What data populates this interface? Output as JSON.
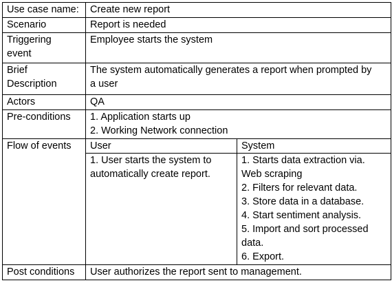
{
  "rows": {
    "use_case_name": {
      "label": "Use case name:",
      "value": "Create new report"
    },
    "scenario": {
      "label": "Scenario",
      "value": "Report is needed"
    },
    "triggering_event": {
      "label_lines": [
        "Triggering",
        "event"
      ],
      "value": "Employee starts the system"
    },
    "brief_description": {
      "label_lines": [
        "Brief",
        "Description"
      ],
      "value_lines": [
        "The system automatically generates a report when prompted by",
        "a user"
      ]
    },
    "actors": {
      "label": "Actors",
      "value": "QA"
    },
    "pre_conditions": {
      "label": "Pre-conditions",
      "items": [
        "1. Application starts up",
        "2. Working Network connection"
      ]
    },
    "flow_of_events": {
      "label": "Flow of events",
      "user_header": "User",
      "system_header": "System",
      "user_lines": [
        "1. User starts the system to",
        "automatically create report."
      ],
      "system_lines": [
        "1. Starts data extraction via.",
        "Web scraping",
        "2. Filters for relevant data.",
        "3. Store data in a database.",
        "4. Start sentiment analysis.",
        "5. Import and sort processed",
        "data.",
        "6. Export."
      ]
    },
    "post_conditions": {
      "label": "Post conditions",
      "value": "User authorizes the report sent to management."
    }
  }
}
